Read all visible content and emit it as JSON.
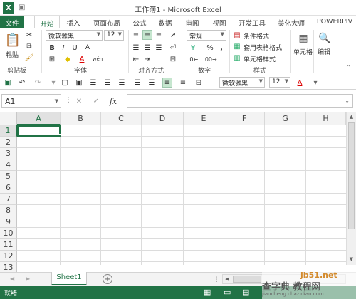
{
  "window": {
    "title": "工作簿1 - Microsoft Excel",
    "app_icon": "excel-logo-icon",
    "accent": "#217346"
  },
  "tabs": [
    {
      "label": "文件"
    },
    {
      "label": "开始"
    },
    {
      "label": "插入"
    },
    {
      "label": "页面布局"
    },
    {
      "label": "公式"
    },
    {
      "label": "数据"
    },
    {
      "label": "审阅"
    },
    {
      "label": "视图"
    },
    {
      "label": "开发工具"
    },
    {
      "label": "美化大师"
    },
    {
      "label": "POWERPIV"
    }
  ],
  "ribbon": {
    "clipboard": {
      "paste_label": "粘贴",
      "group_label": "剪贴板"
    },
    "font": {
      "name": "微软雅黑",
      "size": "12",
      "group_label": "字体",
      "bold": "B",
      "italic": "I",
      "underline": "U",
      "grow": "A",
      "font_color": "A",
      "wen": "wén"
    },
    "alignment": {
      "group_label": "对齐方式"
    },
    "number": {
      "format": "常规",
      "group_label": "数字",
      "percent": "%",
      "comma": ",",
      "currency": "¥"
    },
    "styles": {
      "conditional": "条件格式",
      "table": "套用表格格式",
      "cell": "单元格样式",
      "group_label": "样式"
    },
    "cells": {
      "label": "单元格"
    },
    "editing": {
      "label": "编辑"
    }
  },
  "qat": {
    "font_name": "微软雅黑",
    "font_size": "12"
  },
  "formula_bar": {
    "name_box": "A1",
    "fx": "fx",
    "value": ""
  },
  "grid": {
    "columns": [
      "A",
      "B",
      "C",
      "D",
      "E",
      "F",
      "G",
      "H"
    ],
    "rows": [
      "1",
      "2",
      "3",
      "4",
      "5",
      "6",
      "7",
      "8",
      "9",
      "10",
      "11",
      "12",
      "13"
    ],
    "active_cell": "A1"
  },
  "sheets": [
    {
      "name": "Sheet1"
    }
  ],
  "status": {
    "text": "就绪"
  },
  "watermark": {
    "text": "查字典 教程网",
    "url": "jiaocheng.chazidian.com",
    "site": "jb51.net"
  }
}
